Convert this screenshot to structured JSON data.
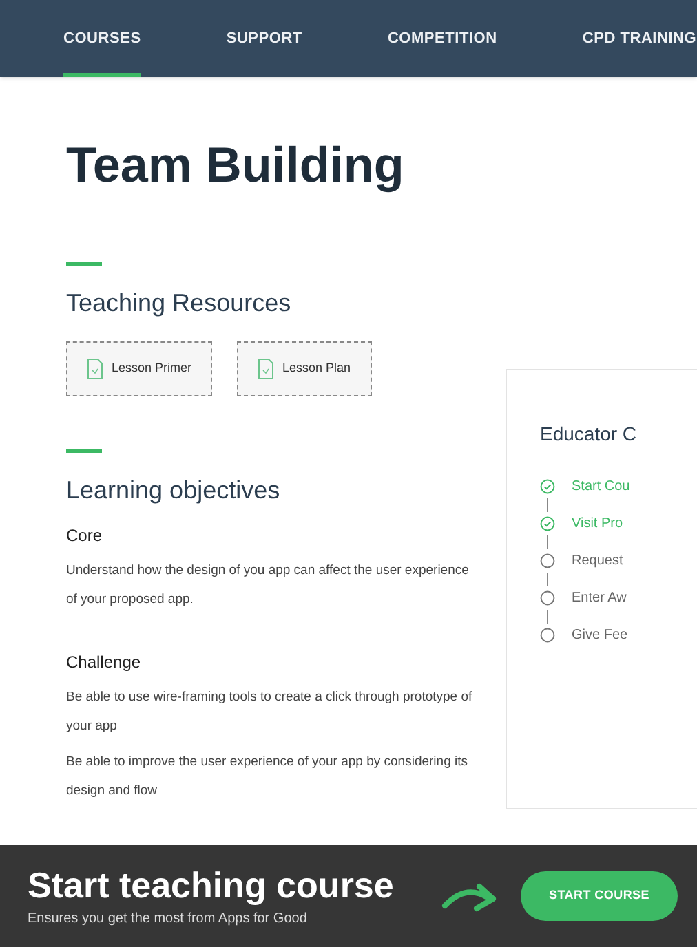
{
  "nav": [
    {
      "label": "COURSES",
      "selected": true
    },
    {
      "label": "SUPPORT",
      "selected": false
    },
    {
      "label": "COMPETITION",
      "selected": false
    },
    {
      "label": "CPD TRAINING",
      "selected": false
    }
  ],
  "title": "Team Building",
  "resources": {
    "heading": "Teaching Resources",
    "items": [
      "Lesson Primer",
      "Lesson Plan"
    ]
  },
  "objectives": {
    "heading": "Learning objectives",
    "groups": [
      {
        "title": "Core",
        "paragraphs": [
          "Understand how the design of you app can affect the user experience of your proposed app."
        ]
      },
      {
        "title": "Challenge",
        "paragraphs": [
          "Be able to use wire-framing tools to create a click through prototype of your app",
          "Be able to improve the user experience of your app by considering its design and flow"
        ]
      }
    ]
  },
  "educator_card": {
    "title": "Educator C",
    "steps": [
      {
        "label": "Start Cou",
        "checked": true
      },
      {
        "label": "Visit Pro",
        "checked": true
      },
      {
        "label": "Request",
        "checked": false
      },
      {
        "label": "Enter Aw",
        "checked": false
      },
      {
        "label": "Give Fee",
        "checked": false
      }
    ]
  },
  "banner": {
    "title": "Start teaching course",
    "subtitle": "Ensures you get the most from Apps for Good",
    "button": "START COURSE"
  }
}
